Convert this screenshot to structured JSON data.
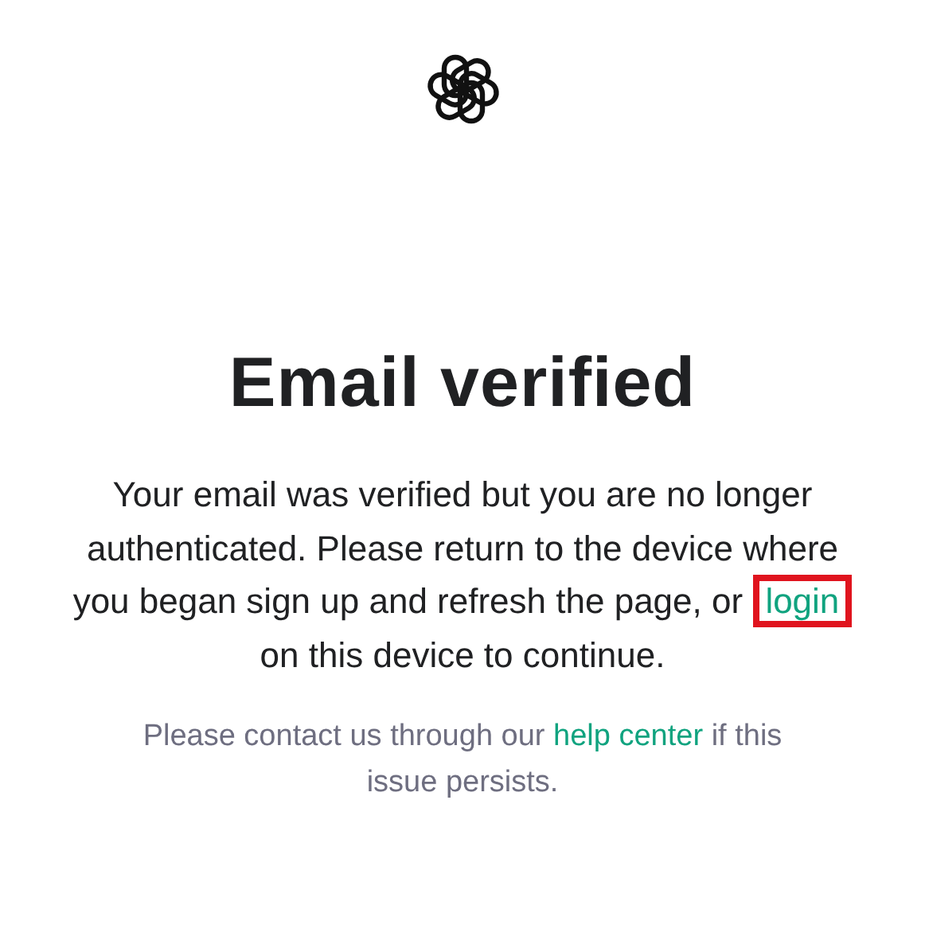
{
  "heading": "Email verified",
  "message": {
    "before": "Your email was verified but you are no longer authenticated. Please return to the device where you began sign up and refresh the page, or ",
    "link": {
      "label": "login",
      "highlighted": true
    },
    "after": " on this device to continue."
  },
  "help": {
    "before": "Please contact us through our ",
    "link": {
      "label": "help center",
      "highlighted": false
    },
    "after": " if this issue persists."
  }
}
